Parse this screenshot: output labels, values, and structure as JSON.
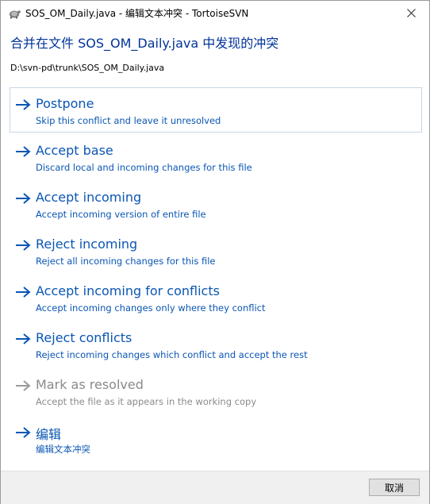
{
  "window": {
    "title": "SOS_OM_Daily.java - 编辑文本冲突 - TortoiseSVN",
    "close_glyph": "✕"
  },
  "content": {
    "heading": "合并在文件 SOS_OM_Daily.java 中发现的冲突",
    "path": "D:\\svn-pd\\trunk\\SOS_OM_Daily.java"
  },
  "options": [
    {
      "title": "Postpone",
      "desc": "Skip this conflict and leave it unresolved",
      "enabled": true
    },
    {
      "title": "Accept base",
      "desc": "Discard local and incoming changes for this file",
      "enabled": true
    },
    {
      "title": "Accept incoming",
      "desc": "Accept incoming version of entire file",
      "enabled": true
    },
    {
      "title": "Reject incoming",
      "desc": "Reject all incoming changes for this file",
      "enabled": true
    },
    {
      "title": "Accept incoming for conflicts",
      "desc": "Accept incoming changes only where they conflict",
      "enabled": true
    },
    {
      "title": "Reject conflicts",
      "desc": "Reject incoming changes which conflict and accept the rest",
      "enabled": true
    },
    {
      "title": "Mark as resolved",
      "desc": "Accept the file as it appears in the working copy",
      "enabled": false
    },
    {
      "title": "编辑",
      "desc": "编辑文本冲突",
      "enabled": true
    }
  ],
  "footer": {
    "cancel_label": "取消"
  },
  "colors": {
    "link_blue": "#0a56b4",
    "heading_blue": "#003399",
    "disabled_gray": "#8a8a8a"
  }
}
